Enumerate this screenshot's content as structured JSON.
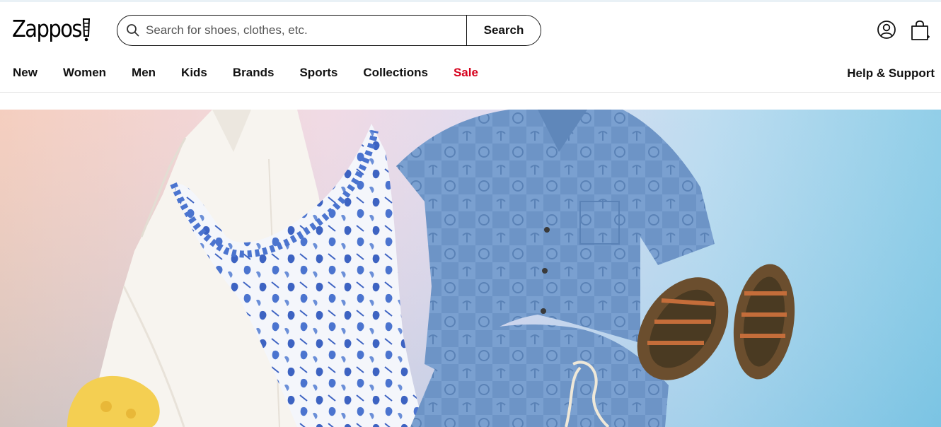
{
  "brand": {
    "logo_text": "Zappos"
  },
  "search": {
    "placeholder": "Search for shoes, clothes, etc.",
    "value": "",
    "button_label": "Search"
  },
  "icons": {
    "search": "search-icon",
    "account": "account-icon",
    "cart": "cart-icon",
    "logo_mark": "zappos-zip-logo-icon"
  },
  "nav": {
    "items": [
      "New",
      "Women",
      "Men",
      "Kids",
      "Brands",
      "Sports",
      "Collections",
      "Sale"
    ],
    "help": "Help & Support"
  },
  "colors": {
    "sale": "#d6001c",
    "text": "#111111",
    "border": "#e3e3e3"
  },
  "hero": {
    "image": "kids summer clothing flat-lay banner"
  }
}
